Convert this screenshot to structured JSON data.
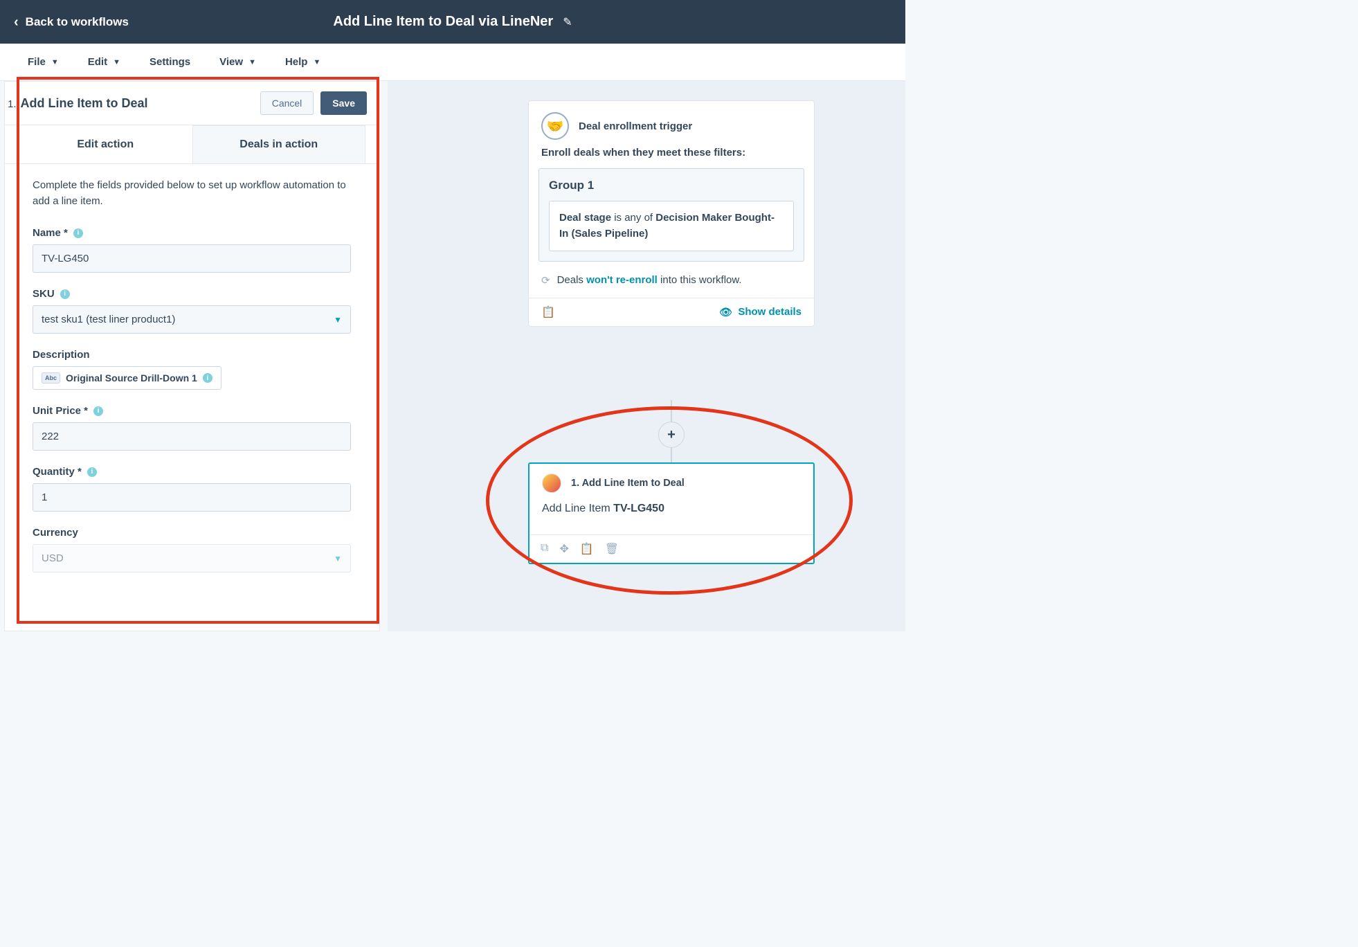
{
  "header": {
    "back_label": "Back to workflows",
    "title": "Add Line Item to Deal via LineNer"
  },
  "menu": {
    "file": "File",
    "edit": "Edit",
    "settings": "Settings",
    "view": "View",
    "help": "Help"
  },
  "panel": {
    "step_num": "1.",
    "title": "Add Line Item to Deal",
    "cancel": "Cancel",
    "save": "Save",
    "tab_edit": "Edit action",
    "tab_deals": "Deals in action",
    "instructions": "Complete the fields provided below to set up workflow automation to add a line item.",
    "fields": {
      "name_label": "Name *",
      "name_value": "TV-LG450",
      "sku_label": "SKU",
      "sku_value": "test sku1 (test liner product1)",
      "description_label": "Description",
      "description_token_badge": "Abc",
      "description_token": "Original Source Drill-Down 1",
      "unit_price_label": "Unit Price *",
      "unit_price_value": "222",
      "quantity_label": "Quantity *",
      "quantity_value": "1",
      "currency_label": "Currency",
      "currency_value": "USD"
    }
  },
  "trigger": {
    "title": "Deal enrollment trigger",
    "subtitle": "Enroll deals when they meet these filters:",
    "group_title": "Group 1",
    "filter_prop": "Deal stage",
    "filter_op": " is any of ",
    "filter_val": "Decision Maker Bought-In (Sales Pipeline)",
    "reenroll_pre": "Deals ",
    "reenroll_link": "won't re-enroll",
    "reenroll_post": " into this workflow.",
    "show_details": "Show details"
  },
  "action": {
    "title": "1. Add Line Item to Deal",
    "body_pre": "Add Line Item ",
    "body_bold": "TV-LG450"
  }
}
